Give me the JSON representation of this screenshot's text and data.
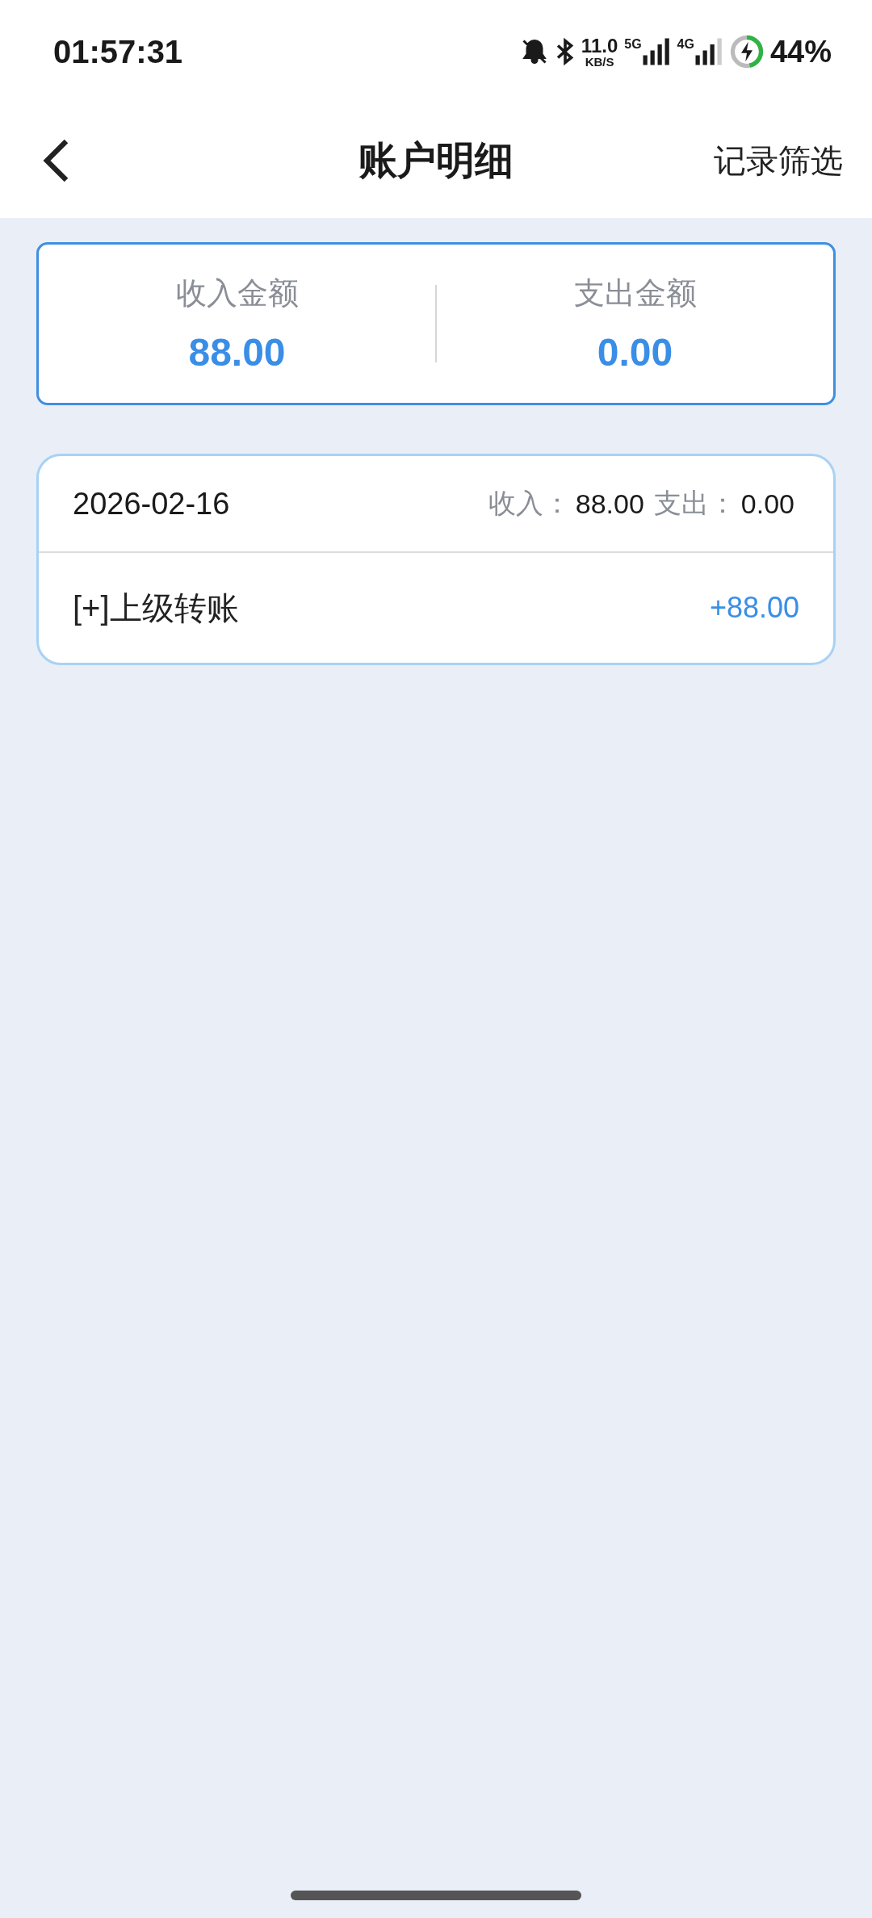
{
  "status_bar": {
    "time": "01:57:31",
    "net_speed": "11.0",
    "net_unit": "KB/S",
    "sim1": "5G",
    "sim2": "4G",
    "battery": "44%"
  },
  "header": {
    "title": "账户明细",
    "action": "记录筛选"
  },
  "summary": [
    {
      "label": "收入金额",
      "amount": "88.00"
    },
    {
      "label": "支出金额",
      "amount": "0.00"
    }
  ],
  "days": [
    {
      "date": "2026-02-16",
      "income_label": "收入：",
      "income": "88.00",
      "expense_label": "支出：",
      "expense": "0.00",
      "entries": [
        {
          "title": "[+]上级转账",
          "amount": "+88.00"
        }
      ]
    }
  ]
}
